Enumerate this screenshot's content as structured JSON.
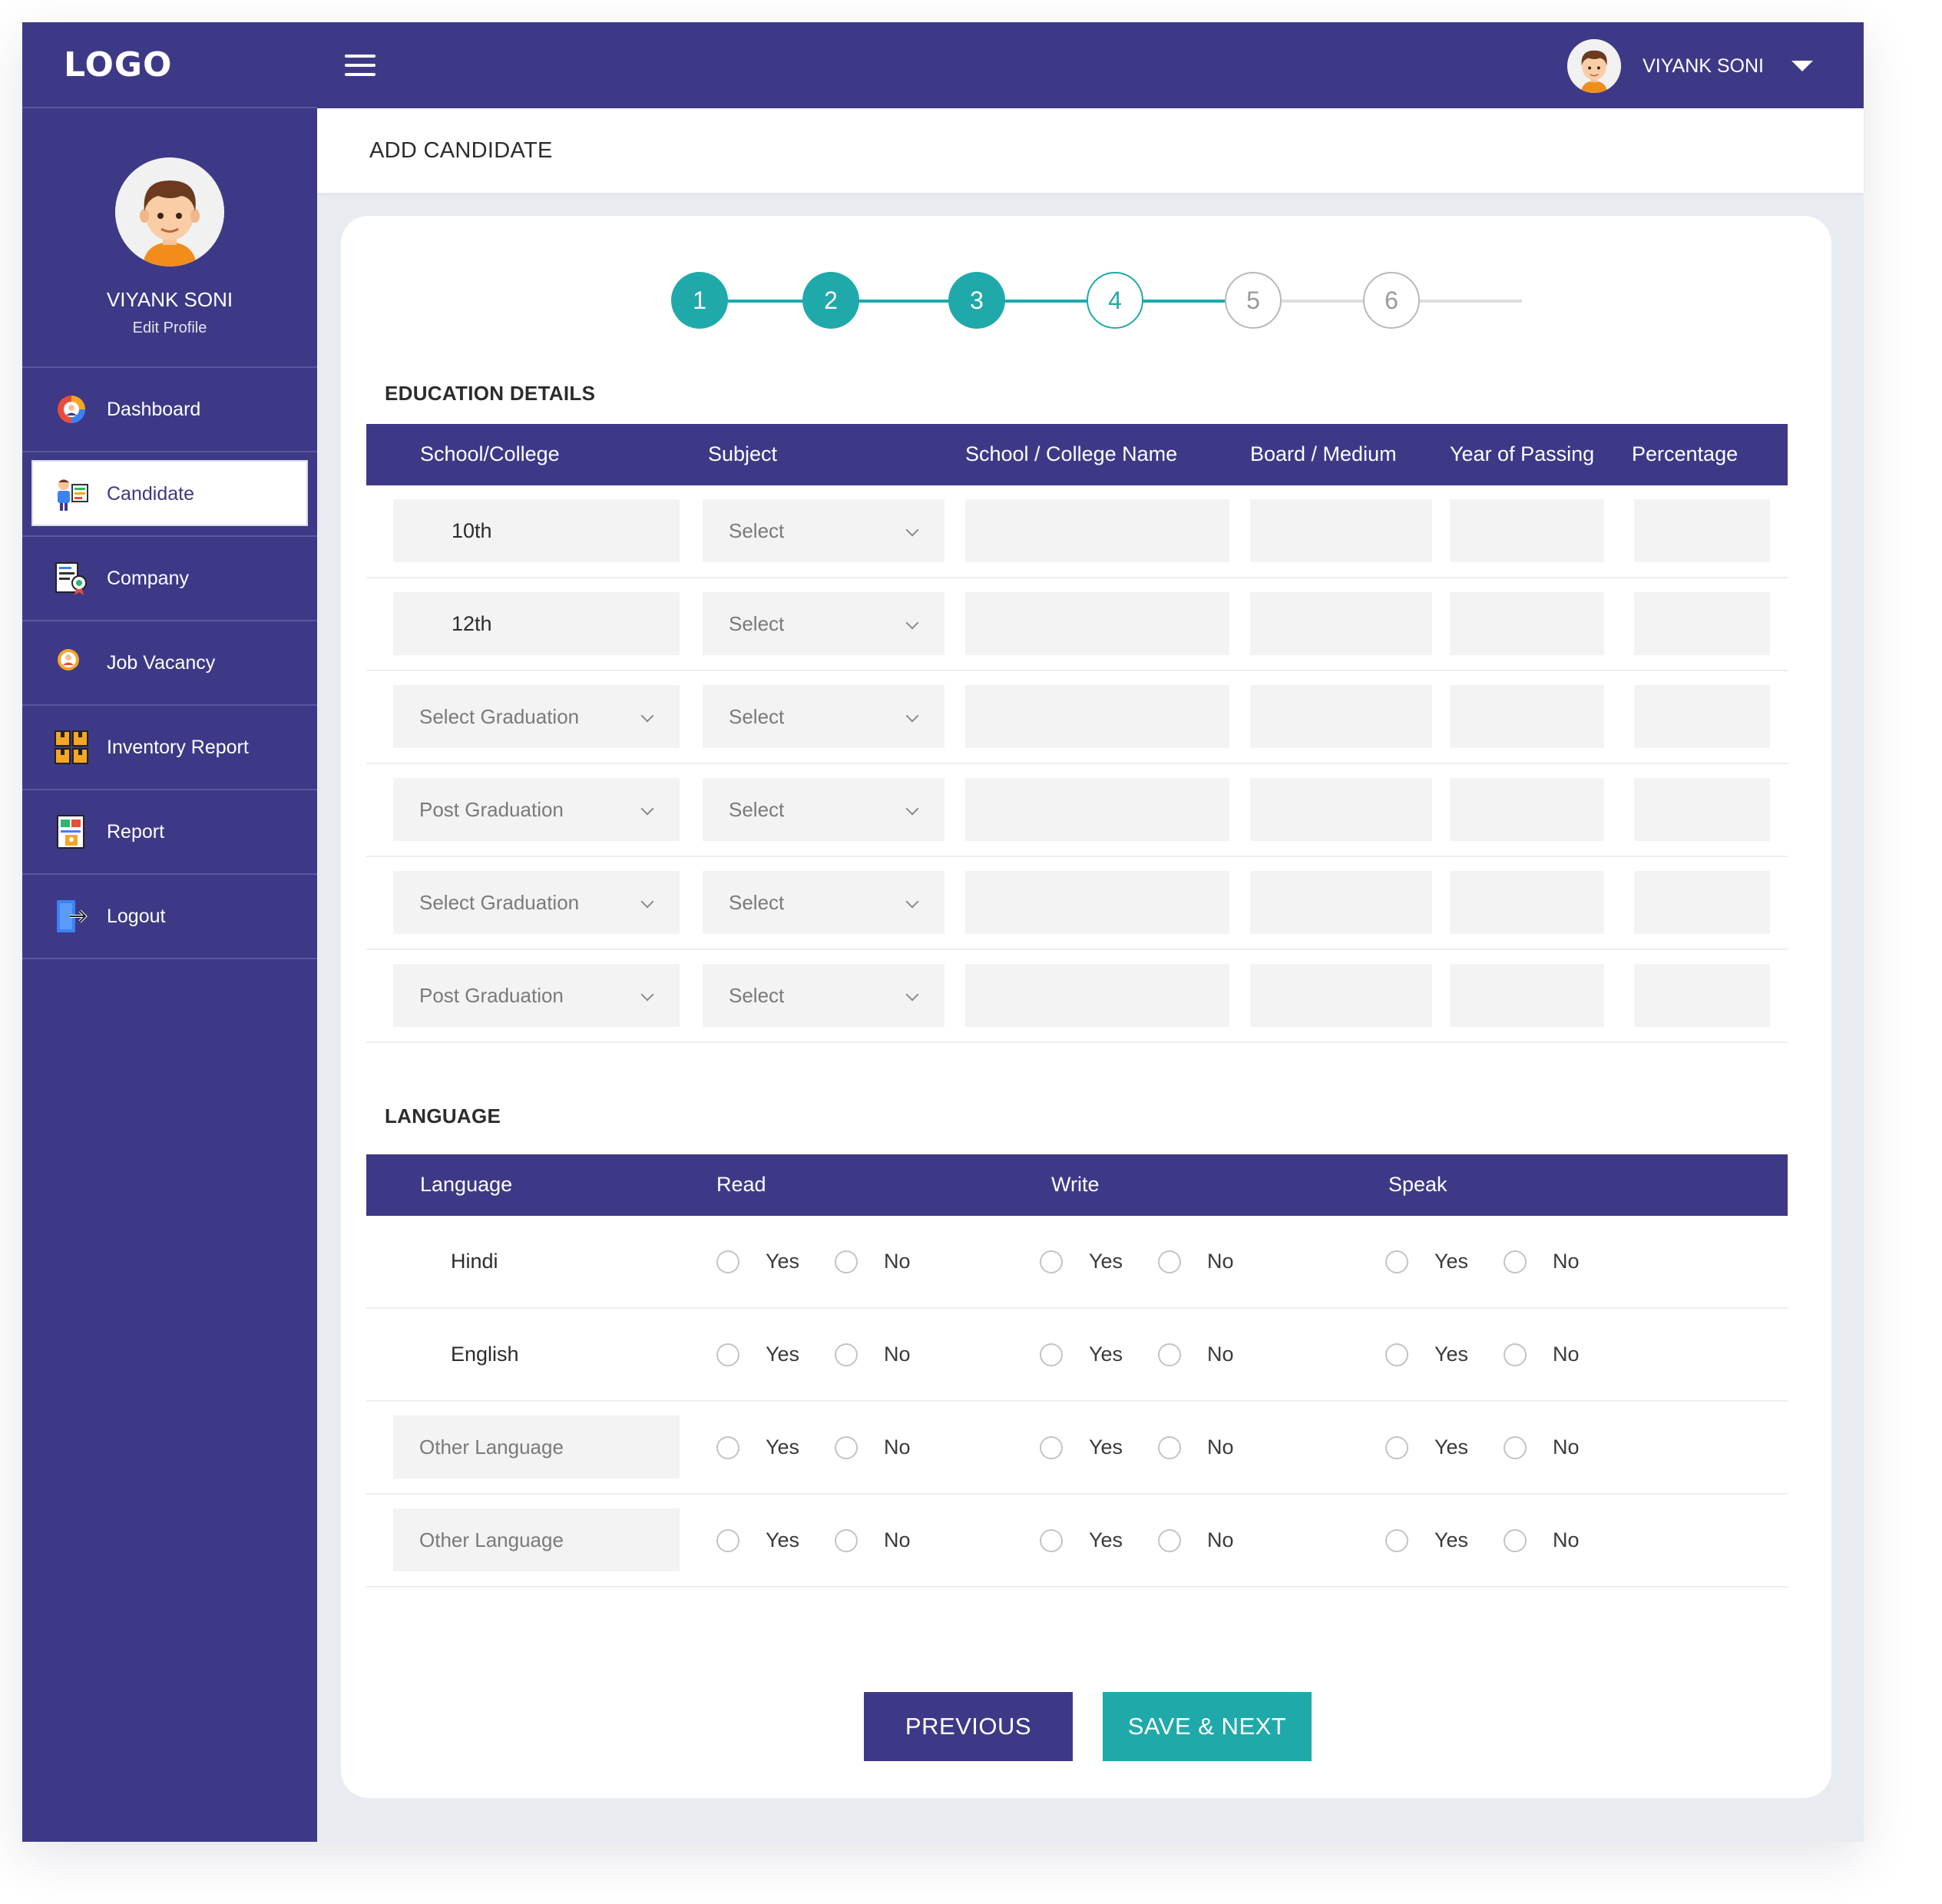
{
  "brand": {
    "logo": "LOGO"
  },
  "user": {
    "name": "VIYANK SONI",
    "edit_label": "Edit Profile"
  },
  "sidebar": {
    "items": [
      {
        "label": "Dashboard",
        "icon": "dashboard-icon"
      },
      {
        "label": "Candidate",
        "icon": "candidate-icon",
        "active": true
      },
      {
        "label": "Company",
        "icon": "company-icon"
      },
      {
        "label": "Job Vacancy",
        "icon": "job-vacancy-icon"
      },
      {
        "label": "Inventory Report",
        "icon": "inventory-report-icon"
      },
      {
        "label": "Report",
        "icon": "report-icon"
      },
      {
        "label": "Logout",
        "icon": "logout-icon"
      }
    ]
  },
  "page": {
    "title": "ADD CANDIDATE"
  },
  "stepper": {
    "steps": [
      "1",
      "2",
      "3",
      "4",
      "5",
      "6"
    ],
    "current": 4
  },
  "education": {
    "title": "EDUCATION DETAILS",
    "columns": [
      "School/College",
      "Subject",
      "School / College Name",
      "Board / Medium",
      "Year of Passing",
      "Percentage"
    ],
    "rows": [
      {
        "level": "10th",
        "subject": "Select"
      },
      {
        "level": "12th",
        "subject": "Select"
      },
      {
        "level": "Select Graduation",
        "subject": "Select"
      },
      {
        "level": "Post Graduation",
        "subject": "Select"
      },
      {
        "level": "Select Graduation",
        "subject": "Select"
      },
      {
        "level": "Post Graduation",
        "subject": "Select"
      }
    ]
  },
  "language": {
    "title": "LANGUAGE",
    "columns": [
      "Language",
      "Read",
      "Write",
      "Speak"
    ],
    "yes_label": "Yes",
    "no_label": "No",
    "rows": [
      {
        "name": "Hindi"
      },
      {
        "name": "English"
      },
      {
        "placeholder": "Other Language"
      },
      {
        "placeholder": "Other Language"
      }
    ]
  },
  "buttons": {
    "previous": "PREVIOUS",
    "save_next": "SAVE & NEXT"
  },
  "colors": {
    "primary": "#3e3986",
    "accent": "#20a9aa"
  }
}
